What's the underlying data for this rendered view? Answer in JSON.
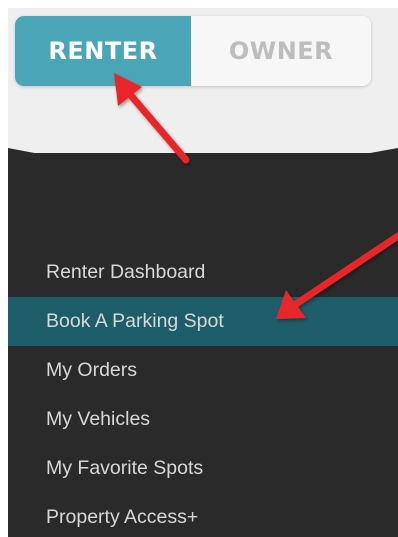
{
  "toggle": {
    "renter_label": "RENTER",
    "owner_label": "OWNER",
    "active": "RENTER"
  },
  "menu": {
    "items": [
      {
        "label": "Renter Dashboard",
        "active": false
      },
      {
        "label": "Book A Parking Spot",
        "active": true
      },
      {
        "label": "My Orders",
        "active": false
      },
      {
        "label": "My Vehicles",
        "active": false
      },
      {
        "label": "My Favorite Spots",
        "active": false
      },
      {
        "label": "Property Access+",
        "active": false
      }
    ]
  },
  "colors": {
    "accent": "#4aa6b6",
    "active_row": "#1d5d69",
    "panel": "#2a2a2a",
    "annotation_arrow": "#e8262a"
  }
}
